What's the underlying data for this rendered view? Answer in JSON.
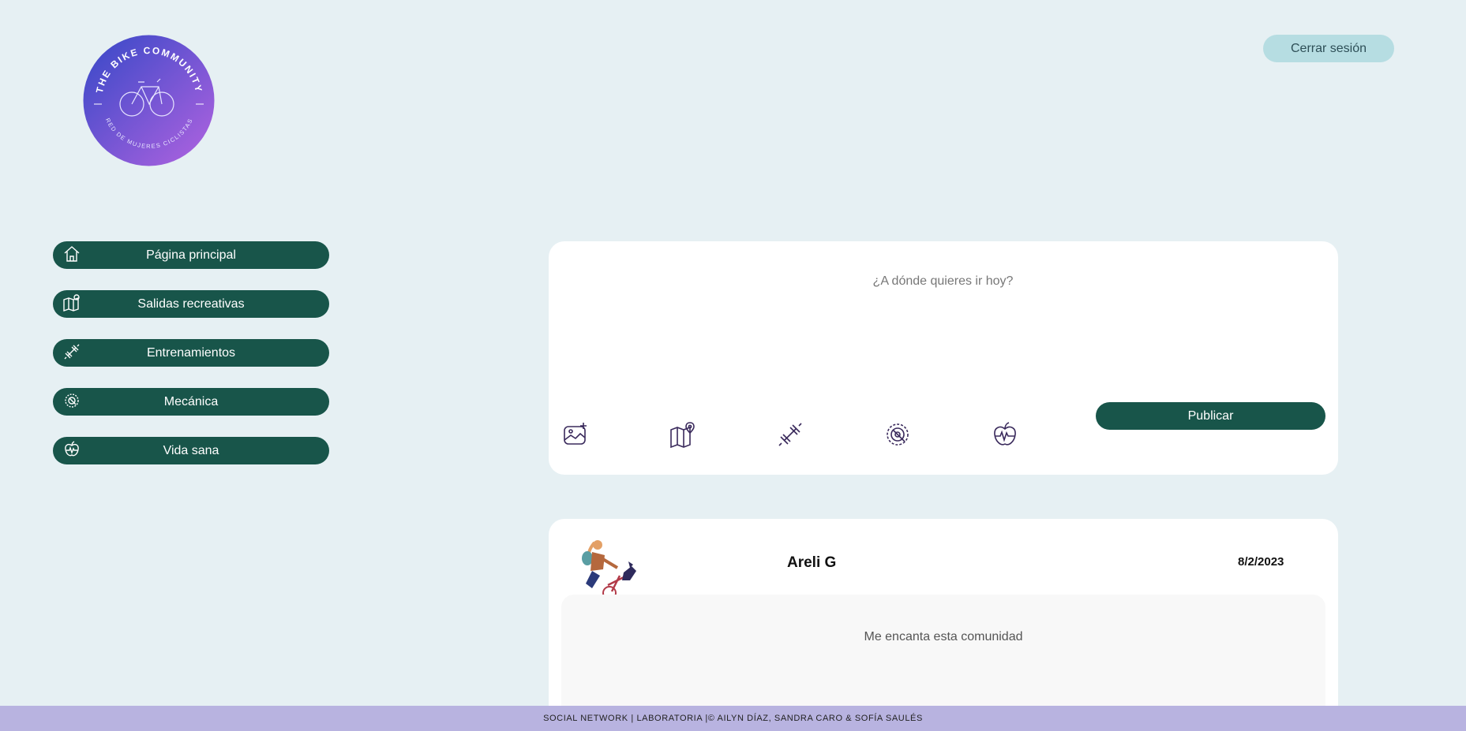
{
  "logo": {
    "text_top": "THE BIKE COMMUNITY",
    "text_bottom": "RED DE MUJERES CICLISTAS",
    "icon": "bicycle-icon"
  },
  "header": {
    "logout_label": "Cerrar sesión"
  },
  "sidebar": {
    "items": [
      {
        "label": "Página principal",
        "icon": "home-icon"
      },
      {
        "label": "Salidas recreativas",
        "icon": "map-pin-icon"
      },
      {
        "label": "Entrenamientos",
        "icon": "dumbbell-icon"
      },
      {
        "label": "Mecánica",
        "icon": "gear-wrench-icon"
      },
      {
        "label": "Vida sana",
        "icon": "apple-heartbeat-icon"
      }
    ]
  },
  "composer": {
    "placeholder": "¿A dónde quieres ir hoy?",
    "publish_label": "Publicar",
    "tools": [
      "image-add-icon",
      "map-pin-icon",
      "dumbbell-icon",
      "gear-wrench-icon",
      "apple-heartbeat-icon"
    ]
  },
  "posts": [
    {
      "author": "Areli G",
      "date": "8/2/2023",
      "text": "Me encanta esta comunidad",
      "avatar": "cyclist-avatar"
    }
  ],
  "footer": {
    "text": "SOCIAL NETWORK | LABORATORIA |© AILYN DÍAZ, SANDRA CARO & SOFÍA SAULÉS"
  },
  "colors": {
    "background": "#e6f0f3",
    "nav_button": "#18554a",
    "logout_button": "#b6dde2",
    "footer": "#b8b3e0",
    "icon_stroke": "#3a2a5c"
  }
}
